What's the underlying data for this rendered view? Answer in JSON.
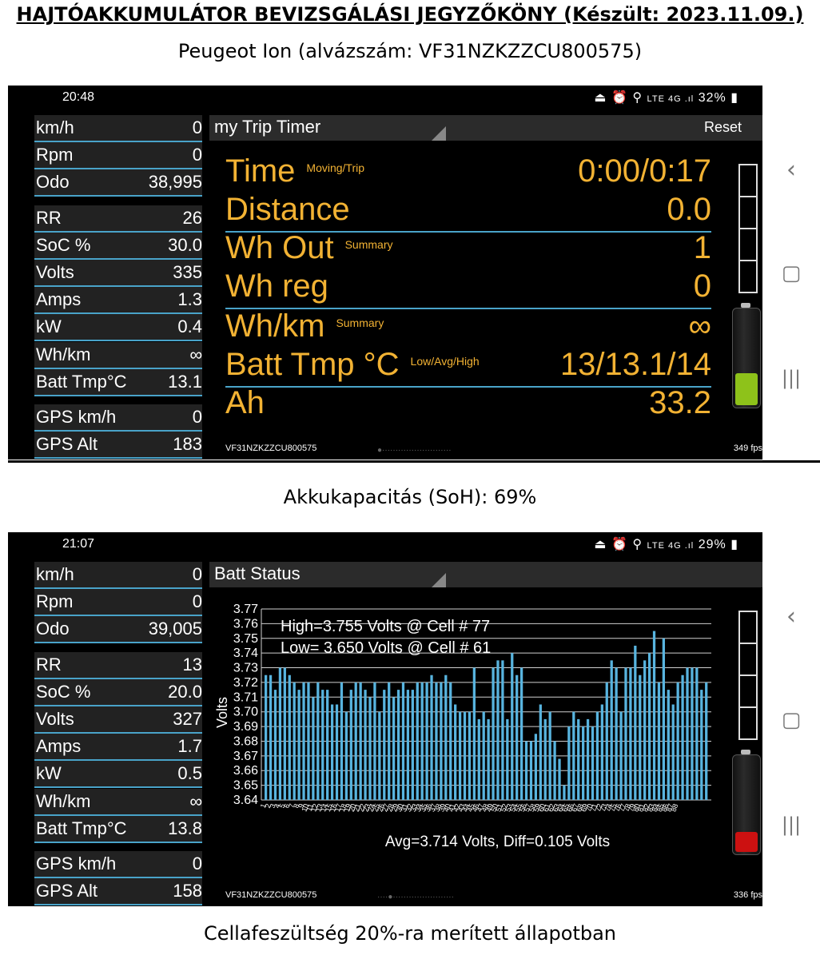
{
  "document": {
    "title": "HAJTÓAKKUMULÁTOR BEVIZSGÁLÁSI JEGYZŐKÖNY (Készült: 2023.11.09.)",
    "subtitle": "Peugeot Ion (alvázszám: VF31NZKZZCU800575)",
    "caption1": "Akkukapacitás (SoH): 69%",
    "caption2": "Cellafeszültség 20%-ra merített állapotban"
  },
  "screen1": {
    "status": {
      "time": "20:48",
      "icons": "⏏ ⏰ ⚲ ᵛᵒˡᵗᵉ 4G .ıl 32%▮",
      "battery": "32%"
    },
    "gauges": [
      {
        "label": "km/h",
        "value": "0"
      },
      {
        "label": "Rpm",
        "value": "0"
      },
      {
        "label": "Odo",
        "value": "38,995"
      },
      {
        "label": "RR",
        "value": "26"
      },
      {
        "label": "SoC %",
        "value": "30.0"
      },
      {
        "label": "Volts",
        "value": "335"
      },
      {
        "label": "Amps",
        "value": "1.3"
      },
      {
        "label": "kW",
        "value": "0.4"
      },
      {
        "label": "Wh/km",
        "value": "∞"
      },
      {
        "label": "Batt Tmp°C",
        "value": "13.1"
      },
      {
        "label": "GPS km/h",
        "value": "0"
      },
      {
        "label": "GPS Alt",
        "value": "183"
      }
    ],
    "header": {
      "title": "my Trip Timer",
      "reset": "Reset"
    },
    "rows": [
      {
        "label": "Time",
        "sub": "Moving/Trip",
        "value": "0:00/0:17"
      },
      {
        "label": "Distance",
        "sub": "",
        "value": "0.0"
      },
      {
        "label": "Wh Out",
        "sub": "Summary",
        "value": "1"
      },
      {
        "label": "Wh reg",
        "sub": "",
        "value": "0"
      },
      {
        "label": "Wh/km",
        "sub": "Summary",
        "value": "∞"
      },
      {
        "label": "Batt Tmp °C",
        "sub": "Low/Avg/High",
        "value": "13/13.1/14"
      },
      {
        "label": "Ah",
        "sub": "",
        "value": "33.2"
      }
    ],
    "vin": "VF31NZKZZCU800575",
    "fps": "349 fps",
    "battery_level": 0.32,
    "battery_color": "#8ec21a"
  },
  "screen2": {
    "status": {
      "time": "21:07",
      "icons": "⏏ ⏰ ⚲ ᵛᵒˡᵗᵉ 4G .ıl 29%▮",
      "battery": "29%"
    },
    "gauges": [
      {
        "label": "km/h",
        "value": "0"
      },
      {
        "label": "Rpm",
        "value": "0"
      },
      {
        "label": "Odo",
        "value": "39,005"
      },
      {
        "label": "RR",
        "value": "13"
      },
      {
        "label": "SoC %",
        "value": "20.0"
      },
      {
        "label": "Volts",
        "value": "327"
      },
      {
        "label": "Amps",
        "value": "1.7"
      },
      {
        "label": "kW",
        "value": "0.5"
      },
      {
        "label": "Wh/km",
        "value": "∞"
      },
      {
        "label": "Batt Tmp°C",
        "value": "13.8"
      },
      {
        "label": "GPS km/h",
        "value": "0"
      },
      {
        "label": "GPS Alt",
        "value": "158"
      }
    ],
    "header": {
      "title": "Batt Status"
    },
    "vin": "VF31NZKZZCU800575",
    "fps": "336 fps",
    "battery_level": 0.2,
    "battery_color": "#cc1111"
  },
  "chart_data": {
    "type": "bar",
    "ylabel": "Volts",
    "ylim": [
      3.64,
      3.77
    ],
    "yticks": [
      "3.77",
      "3.76",
      "3.75",
      "3.74",
      "3.73",
      "3.72",
      "3.71",
      "3.70",
      "3.69",
      "3.68",
      "3.67",
      "3.66",
      "3.65",
      "3.64"
    ],
    "grid": true,
    "annotations": [
      "High=3.755 Volts @ Cell # 77",
      "Low= 3.650 Volts @ Cell # 61"
    ],
    "footer": "Avg=3.714 Volts, Diff=0.105 Volts",
    "x": [
      1,
      2,
      3,
      4,
      5,
      6,
      7,
      8,
      9,
      10,
      11,
      12,
      13,
      14,
      15,
      16,
      17,
      18,
      19,
      20,
      21,
      22,
      23,
      24,
      25,
      26,
      27,
      28,
      29,
      30,
      31,
      32,
      33,
      34,
      35,
      36,
      37,
      38,
      39,
      40,
      41,
      42,
      43,
      44,
      45,
      46,
      47,
      48,
      49,
      50,
      51,
      52,
      53,
      54,
      55,
      56,
      57,
      58,
      59,
      60,
      61,
      62,
      63,
      64,
      65,
      66,
      67,
      68,
      69,
      70,
      71,
      72,
      73,
      74,
      75,
      76,
      77,
      78,
      79,
      80,
      81,
      82,
      83,
      84,
      85,
      86,
      87,
      88
    ],
    "series": [
      {
        "values": [
          3.725,
          3.725,
          3.715,
          3.73,
          3.73,
          3.725,
          3.72,
          3.715,
          3.72,
          3.72,
          3.71,
          3.72,
          3.715,
          3.715,
          3.705,
          3.705,
          3.72,
          3.7,
          3.715,
          3.72,
          3.72,
          3.715,
          3.71,
          3.72,
          3.7,
          3.715,
          3.72,
          3.71,
          3.715,
          3.72,
          3.715,
          3.715,
          3.72,
          3.72,
          3.72,
          3.725,
          3.72,
          3.72,
          3.725,
          3.72,
          3.705,
          3.7,
          3.7,
          3.7,
          3.73,
          3.695,
          3.7,
          3.695,
          3.73,
          3.735,
          3.735,
          3.695,
          3.74,
          3.725,
          3.73,
          3.68,
          3.68,
          3.685,
          3.705,
          3.695,
          3.7,
          3.68,
          3.668,
          3.65,
          3.69,
          3.7,
          3.695,
          3.69,
          3.695,
          3.69,
          3.7,
          3.705,
          3.72,
          3.735,
          3.73,
          3.7,
          3.73,
          3.73,
          3.745,
          3.725,
          3.735,
          3.74,
          3.755,
          3.72,
          3.75,
          3.715,
          3.705,
          3.72,
          3.725,
          3.73,
          3.73,
          3.73,
          3.715,
          3.72
        ]
      }
    ]
  }
}
